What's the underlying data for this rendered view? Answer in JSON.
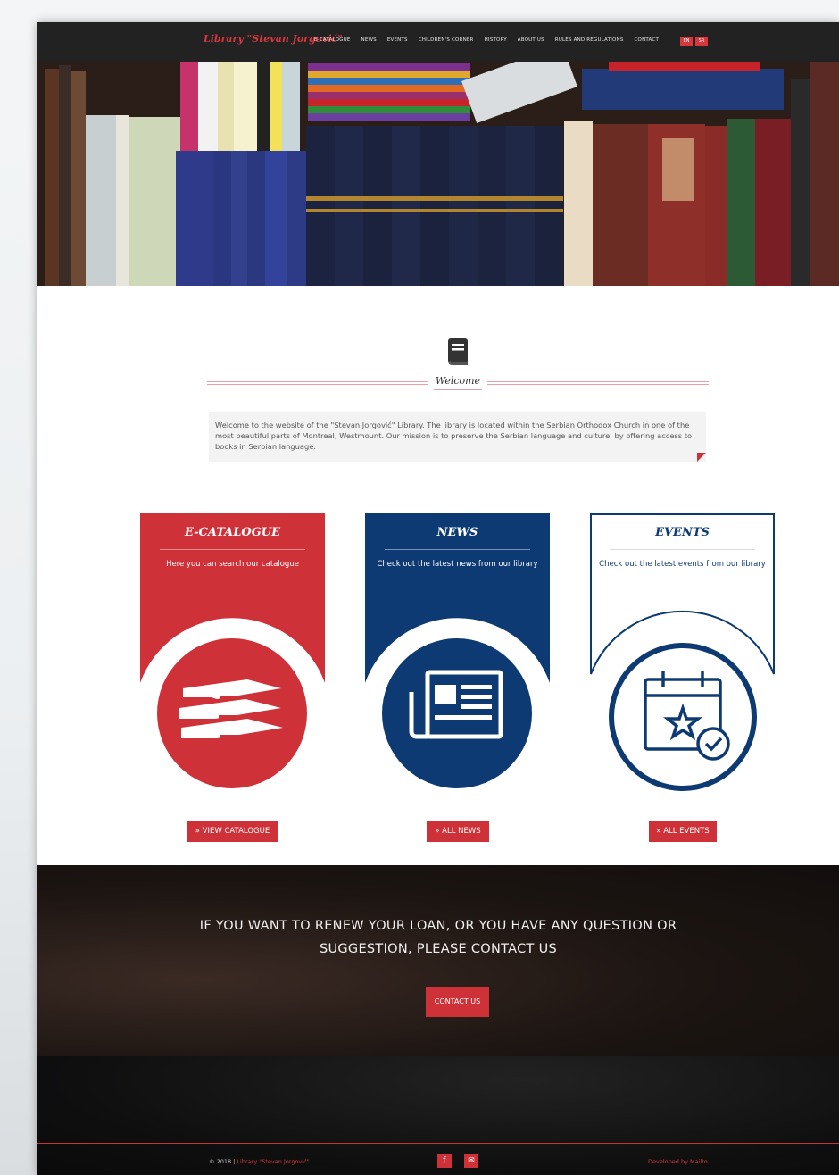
{
  "nav": {
    "brand": "Library \"Stevan Jorgović\"",
    "items": [
      {
        "label": "E-CATALOGUE"
      },
      {
        "label": "NEWS"
      },
      {
        "label": "EVENTS"
      },
      {
        "label": "CHILDREN'S CORNER"
      },
      {
        "label": "HISTORY"
      },
      {
        "label": "ABOUT US"
      },
      {
        "label": "RULES AND REGULATIONS"
      },
      {
        "label": "CONTACT"
      }
    ],
    "lang": [
      "EN",
      "SR"
    ]
  },
  "welcome": {
    "title": "Welcome",
    "text": "Welcome to the website of the \"Stevan Jorgović\" Library. The library is located within the Serbian Orthodox Church in one of the most beautiful parts of Montreal, Westmount. Our mission is to preserve the Serbian language and culture, by offering access to books in Serbian language."
  },
  "cards": [
    {
      "title": "E-CATALOGUE",
      "desc": "Here you can search our catalogue",
      "button": "» VIEW CATALOGUE",
      "color": "#cf3138"
    },
    {
      "title": "NEWS",
      "desc": "Check out the latest news from our library",
      "button": "» ALL NEWS",
      "color": "#0d3a73"
    },
    {
      "title": "EVENTS",
      "desc": "Check out the latest events from our library",
      "button": "» ALL EVENTS",
      "color": "#0d3a73"
    }
  ],
  "contact": {
    "line1": "IF YOU WANT TO RENEW YOUR LOAN, OR YOU HAVE ANY QUESTION OR",
    "line2": "SUGGESTION, PLEASE CONTACT US",
    "button": "CONTACT US"
  },
  "footer": {
    "copyright": "© 2018 | ",
    "library_link": "Library \"Stevan Jorgović\"",
    "facebook": "f",
    "email": "✉",
    "developed": "Developed by Mailto"
  },
  "colors": {
    "accent": "#cf3138",
    "navy": "#0d3a73",
    "nav_bg": "#222222"
  }
}
